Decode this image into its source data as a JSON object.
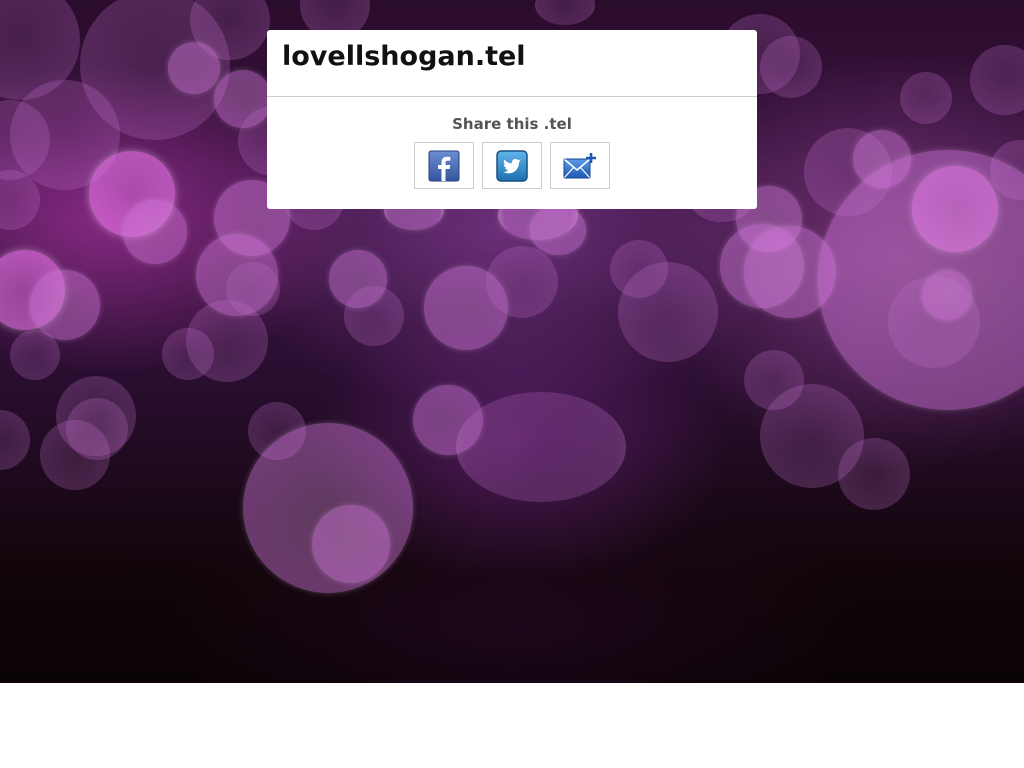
{
  "card": {
    "title": "lovellshogan.tel"
  },
  "share": {
    "heading": "Share this .tel",
    "buttons": [
      {
        "icon": "facebook-icon",
        "color": "#3b5998"
      },
      {
        "icon": "twitter-icon",
        "color": "#2a86c6"
      },
      {
        "icon": "email-add-icon",
        "color": "#3a7bd0"
      }
    ]
  },
  "colors": {
    "background_purple": "#3a1440",
    "card_background": "#ffffff",
    "heading_text": "#555555"
  }
}
